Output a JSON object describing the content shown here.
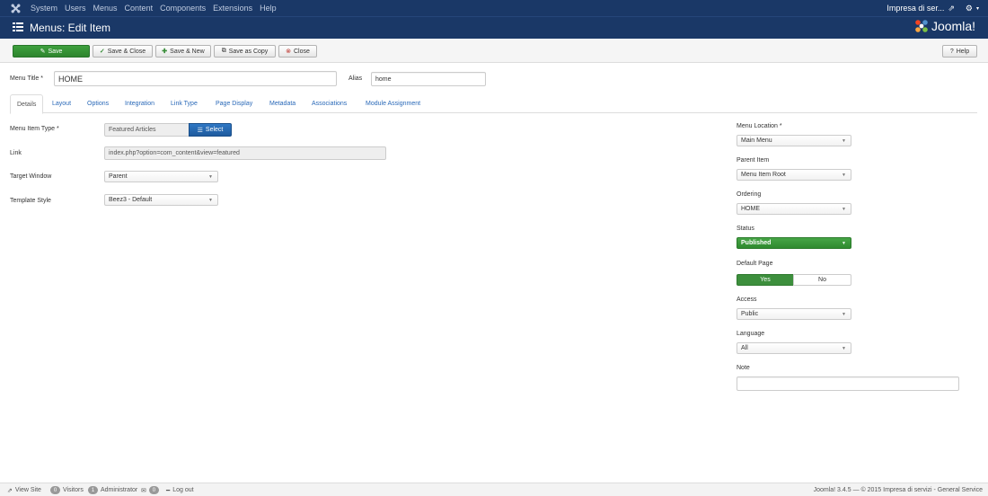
{
  "topnav": {
    "items": [
      "System",
      "Users",
      "Menus",
      "Content",
      "Components",
      "Extensions",
      "Help"
    ],
    "site_name": "Impresa di ser..."
  },
  "header": {
    "title": "Menus: Edit Item",
    "brand": "Joomla!"
  },
  "toolbar": {
    "save": "Save",
    "save_close": "Save & Close",
    "save_new": "Save & New",
    "save_copy": "Save as Copy",
    "close": "Close",
    "help": "Help"
  },
  "form": {
    "menu_title_label": "Menu Title *",
    "menu_title_value": "HOME",
    "alias_label": "Alias",
    "alias_value": "home"
  },
  "tabs": [
    "Details",
    "Layout",
    "Options",
    "Integration",
    "Link Type",
    "Page Display",
    "Metadata",
    "Associations",
    "Module Assignment"
  ],
  "details": {
    "item_type_label": "Menu Item Type *",
    "item_type_value": "Featured Articles",
    "select_button": "Select",
    "link_label": "Link",
    "link_value": "index.php?option=com_content&view=featured",
    "target_label": "Target Window",
    "target_value": "Parent",
    "template_label": "Template Style",
    "template_value": "Beez3 - Default"
  },
  "sidebar": {
    "location_label": "Menu Location *",
    "location_value": "Main Menu",
    "parent_label": "Parent Item",
    "parent_value": "Menu Item Root",
    "ordering_label": "Ordering",
    "ordering_value": "HOME",
    "status_label": "Status",
    "status_value": "Published",
    "default_label": "Default Page",
    "default_yes": "Yes",
    "default_no": "No",
    "access_label": "Access",
    "access_value": "Public",
    "language_label": "Language",
    "language_value": "All",
    "note_label": "Note",
    "note_value": ""
  },
  "footer": {
    "view_site": "View Site",
    "visitors_count": "0",
    "visitors": "Visitors",
    "admin_count": "1",
    "administrator": "Administrator",
    "messages_count": "0",
    "logout": "Log out",
    "copyright": "Joomla! 3.4.5 — © 2015 Impresa di servizi - General Service"
  },
  "colors": {
    "nav_bg": "#1a3867",
    "save_green": "#2e852e",
    "select_blue": "#1e5a9d",
    "link_blue": "#2a69b8"
  }
}
